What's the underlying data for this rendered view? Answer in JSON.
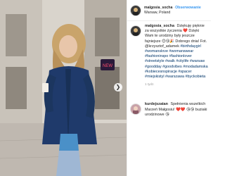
{
  "post": {
    "username": "malgosia_socha",
    "follow_label": "Obserwowanie",
    "location": "Warsaw, Poland",
    "caption_username": "malgosia_socha",
    "caption_text": "Dziękuję pięknie za wszystkie życzenia ❤️ Dzięki Wam te urodziny były jeszcze fajniejsze 😊😘🎉 Dobrego dnia! Fot. @krzysztof_adamek",
    "caption_hashtags": "#birthdaygirl #womanslove #womanswear #fashioninspo #fashionlover #streetstyle #walk #citylife #warsaw #goodday #goodvibes #modadamska #kobiecesnspiracje #spacer #miejskistyl #warszawa #byckobieta",
    "caption_time": "1 tydz.",
    "comment_username": "kurdejszatan",
    "comment_text": "Spełnienia wszelkich Marzeń Małgosiu! ❤️❤️ 😘😘 buziaki urodzinowe 😘"
  },
  "colors": {
    "link_blue": "#3897f0",
    "hashtag_blue": "#003569",
    "jacket_denim": "#1f3a6b",
    "shirt_blue": "#4a90c8"
  },
  "icons": {
    "next": "chevron-right-icon"
  }
}
